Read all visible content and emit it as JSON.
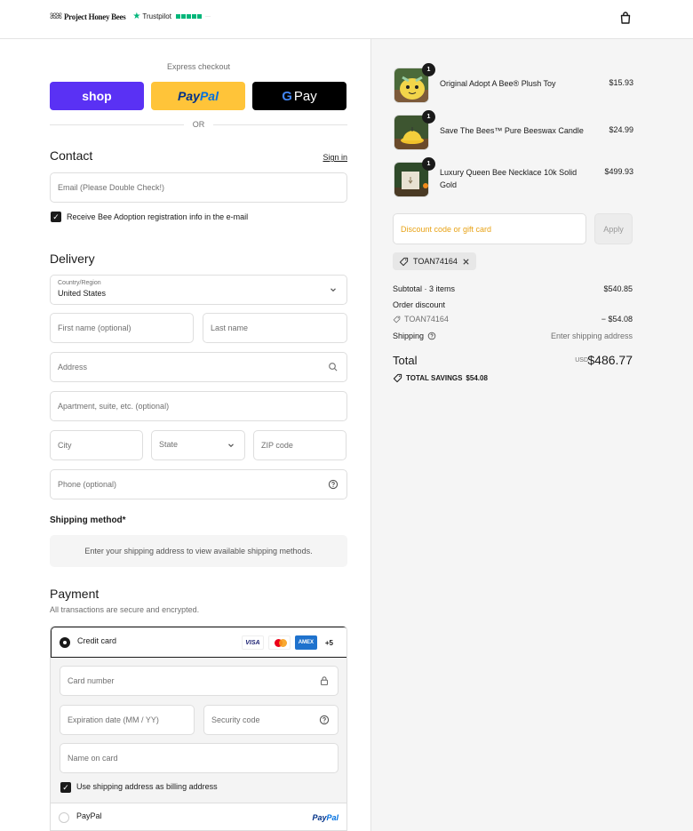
{
  "header": {
    "brand": "Project Honey Bees",
    "bees_glyph": "ꕤꕤ",
    "trustpilot": "Trustpilot"
  },
  "express": {
    "title": "Express checkout",
    "shop_label": "shop",
    "paypal_pay": "Pay",
    "paypal_pal": "Pal",
    "gpay_g": "G",
    "gpay_label": "Pay",
    "or_label": "OR"
  },
  "contact": {
    "title": "Contact",
    "sign_in": "Sign in",
    "email_placeholder": "Email (Please Double Check!)",
    "newsletter_label": "Receive Bee Adoption registration info in the e-mail",
    "newsletter_checked": true
  },
  "delivery": {
    "title": "Delivery",
    "country_label": "Country/Region",
    "country_value": "United States",
    "first_name": "First name (optional)",
    "last_name": "Last name",
    "address": "Address",
    "apartment": "Apartment, suite, etc. (optional)",
    "city": "City",
    "state": "State",
    "zip": "ZIP code",
    "phone": "Phone (optional)"
  },
  "shipping_method": {
    "title": "Shipping method*",
    "message": "Enter your shipping address to view available shipping methods."
  },
  "payment": {
    "title": "Payment",
    "subtitle": "All transactions are secure and encrypted.",
    "credit_card_label": "Credit card",
    "card_brands": [
      "VISA",
      "AMEX"
    ],
    "more_cards": "+5",
    "card_number": "Card number",
    "expiration": "Expiration date (MM / YY)",
    "security_code": "Security code",
    "name_on_card": "Name on card",
    "billing_same_label": "Use shipping address as billing address",
    "billing_same_checked": true,
    "paypal_label": "PayPal",
    "paypal_logo_pay": "Pay",
    "paypal_logo_pal": "Pal"
  },
  "order": {
    "items": [
      {
        "name": "Original Adopt A Bee® Plush Toy",
        "price": "$15.93",
        "qty": "1"
      },
      {
        "name": "Save The Bees™ Pure Beeswax Candle",
        "price": "$24.99",
        "qty": "1"
      },
      {
        "name": "Luxury Queen Bee Necklace 10k Solid Gold",
        "price": "$499.93",
        "qty": "1"
      }
    ],
    "discount_placeholder": "Discount code or gift card",
    "apply_label": "Apply",
    "applied_code": "TOAN74164",
    "subtotal_label": "Subtotal · 3 items",
    "subtotal_value": "$540.85",
    "order_discount_label": "Order discount",
    "discount_code": "TOAN74164",
    "discount_value": "− $54.08",
    "shipping_label": "Shipping",
    "shipping_value": "Enter shipping address",
    "total_label": "Total",
    "currency": "USD",
    "total_value": "$486.77",
    "savings_label": "TOTAL SAVINGS",
    "savings_value": "$54.08"
  },
  "colors": {
    "shop_purple": "#5a31f4",
    "paypal_yellow": "#ffc439",
    "accent_orange": "#e8a317",
    "trustpilot_green": "#00b67a"
  }
}
